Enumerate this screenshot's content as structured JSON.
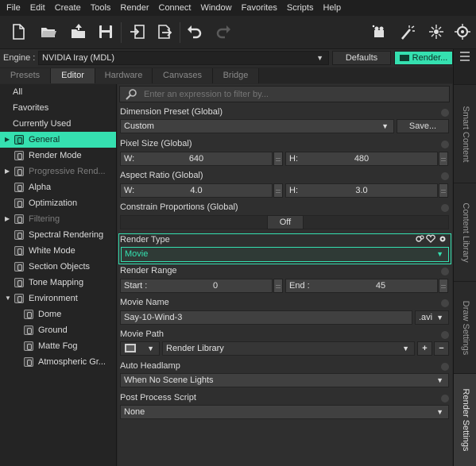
{
  "menu": [
    "File",
    "Edit",
    "Create",
    "Tools",
    "Render",
    "Connect",
    "Window",
    "Favorites",
    "Scripts",
    "Help"
  ],
  "engine": {
    "label": "Engine :",
    "value": "NVIDIA Iray (MDL)",
    "defaults_label": "Defaults",
    "render_label": "Render..."
  },
  "tabs": [
    "Presets",
    "Editor",
    "Hardware",
    "Canvases",
    "Bridge"
  ],
  "left": {
    "items": [
      "All",
      "Favorites",
      "Currently Used",
      "General",
      "Render Mode",
      "Progressive Rend...",
      "Alpha",
      "Optimization",
      "Filtering",
      "Spectral Rendering",
      "White Mode",
      "Section Objects",
      "Tone Mapping",
      "Environment",
      "Dome",
      "Ground",
      "Matte Fog",
      "Atmospheric Gr..."
    ]
  },
  "search": {
    "placeholder": "Enter an expression to filter by..."
  },
  "props": {
    "dimension_preset": {
      "label": "Dimension Preset (Global)",
      "value": "Custom",
      "save_label": "Save..."
    },
    "pixel_size": {
      "label": "Pixel Size (Global)",
      "w_label": "W:",
      "w_value": "640",
      "h_label": "H:",
      "h_value": "480"
    },
    "aspect_ratio": {
      "label": "Aspect Ratio (Global)",
      "w_label": "W:",
      "w_value": "4.0",
      "h_label": "H:",
      "h_value": "3.0"
    },
    "constrain": {
      "label": "Constrain Proportions (Global)",
      "value": "Off"
    },
    "render_type": {
      "label": "Render Type",
      "value": "Movie"
    },
    "render_range": {
      "label": "Render Range",
      "start_label": "Start :",
      "start_value": "0",
      "end_label": "End :",
      "end_value": "45"
    },
    "movie_name": {
      "label": "Movie Name",
      "value": "Say-10-Wind-3",
      "ext": ".avi"
    },
    "movie_path": {
      "label": "Movie Path",
      "value": "Render Library",
      "add": "+",
      "remove": "−"
    },
    "auto_headlamp": {
      "label": "Auto Headlamp",
      "value": "When No Scene Lights"
    },
    "post_process": {
      "label": "Post Process Script",
      "value": "None"
    }
  },
  "side_tabs": [
    "Smart Content",
    "Content Library",
    "Draw Settings",
    "Render Settings"
  ]
}
